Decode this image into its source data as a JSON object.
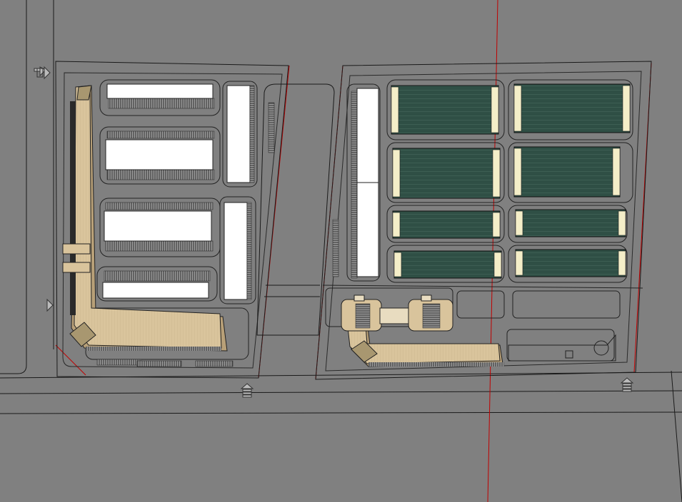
{
  "scene": {
    "description_visible_text": "",
    "colors": {
      "ground": "#808080",
      "road_line": "#1a1a1a",
      "boundary_red": "#c00000",
      "white_building": "#ffffff",
      "dark_building": "#2f4f45",
      "dark_building_stripe": "#3f5f55",
      "tan_building": "#d8c39a",
      "tan_shadow": "#b8a078",
      "end_cap": "#f4eec8",
      "hatch": "#2a2a2a"
    },
    "icons": {
      "entry_arrow_top_left": "double-chevron-right-icon",
      "entry_arrow_mid_left": "triangle-right-icon",
      "gate_south_left": "gate-up-arrow-icon",
      "gate_south_right": "gate-up-arrow-icon"
    },
    "counts": {
      "west_white_rows": 4,
      "west_vertical_white_blocks": 2,
      "east_dark_blocks": 8
    }
  }
}
